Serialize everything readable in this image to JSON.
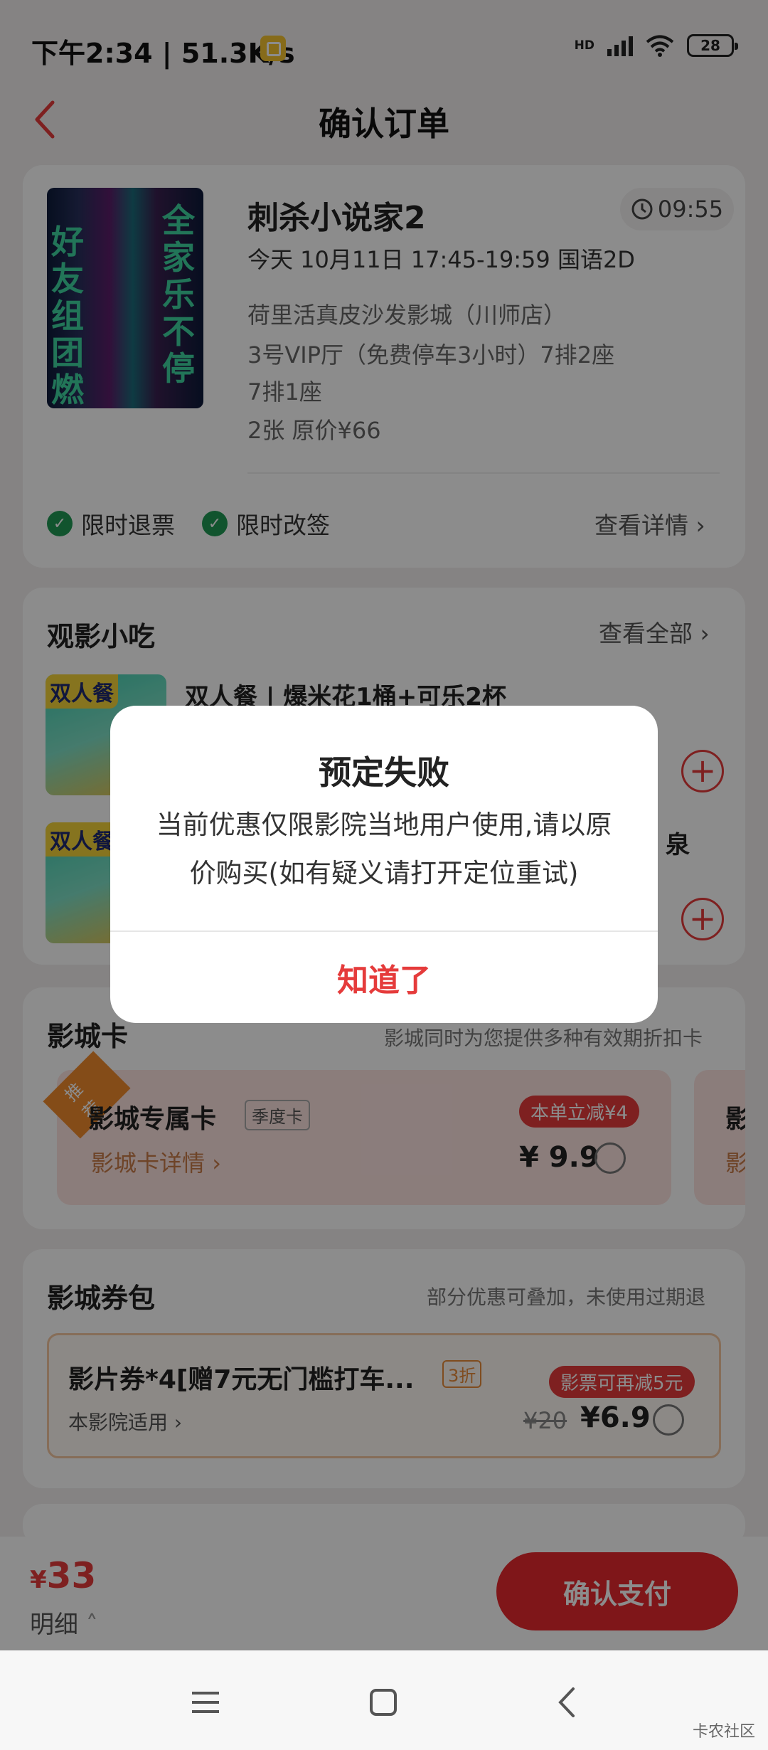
{
  "status_bar": {
    "time": "下午2:34 | 51.3K/s",
    "network": "HD",
    "battery": "28"
  },
  "header": {
    "title": "确认订单"
  },
  "movie": {
    "poster_text_left": "好友组团燃",
    "poster_text_right": "全家乐不停",
    "title": "刺杀小说家2",
    "countdown": "09:55",
    "showtime": "今天 10月11日 17:45-19:59 国语2D",
    "cinema": "荷里活真皮沙发影城（川师店）",
    "hall": "3号VIP厅（免费停车3小时）7排2座",
    "seat2": "7排1座",
    "ticket_info": "2张 原价¥66",
    "badges": [
      "限时退票",
      "限时改签"
    ],
    "detail_link": "查看详情"
  },
  "snacks": {
    "title": "观影小吃",
    "view_all": "查看全部",
    "items": [
      {
        "tag": "双人餐",
        "name": "双人餐 | 爆米花1桶+可乐2杯"
      },
      {
        "tag": "双人餐",
        "name": "泉"
      }
    ]
  },
  "cinema_card": {
    "title": "影城卡",
    "note": "影城同时为您提供多种有效期折扣卡",
    "ribbon": "推荐",
    "offer_title": "影城专属卡",
    "offer_tag": "季度卡",
    "offer_link": "影城卡详情",
    "offer_discount": "本单立减¥4",
    "offer_price": "¥ 9.9",
    "offer2_title": "影",
    "offer2_sub": "影"
  },
  "voucher": {
    "title": "影城券包",
    "note": "部分优惠可叠加，未使用过期退",
    "name": "影片券*4[赠7元无门槛打车...",
    "discount": "3折",
    "scope": "本影院适用",
    "extra": "影票可再减5元",
    "original_price": "¥20",
    "price": "¥6.9"
  },
  "pay_bar": {
    "total_symbol": "¥",
    "total_value": "33",
    "detail": "明细",
    "pay_button": "确认支付"
  },
  "dialog": {
    "title": "预定失败",
    "message": "当前优惠仅限影院当地用户使用,请以原价购买(如有疑义请打开定位重试)",
    "button": "知道了"
  },
  "watermark": "卡农社区",
  "colors": {
    "accent_red": "#e53b3b",
    "check_green": "#1f9a55",
    "overlay": "rgba(0,0,0,0.45)"
  }
}
